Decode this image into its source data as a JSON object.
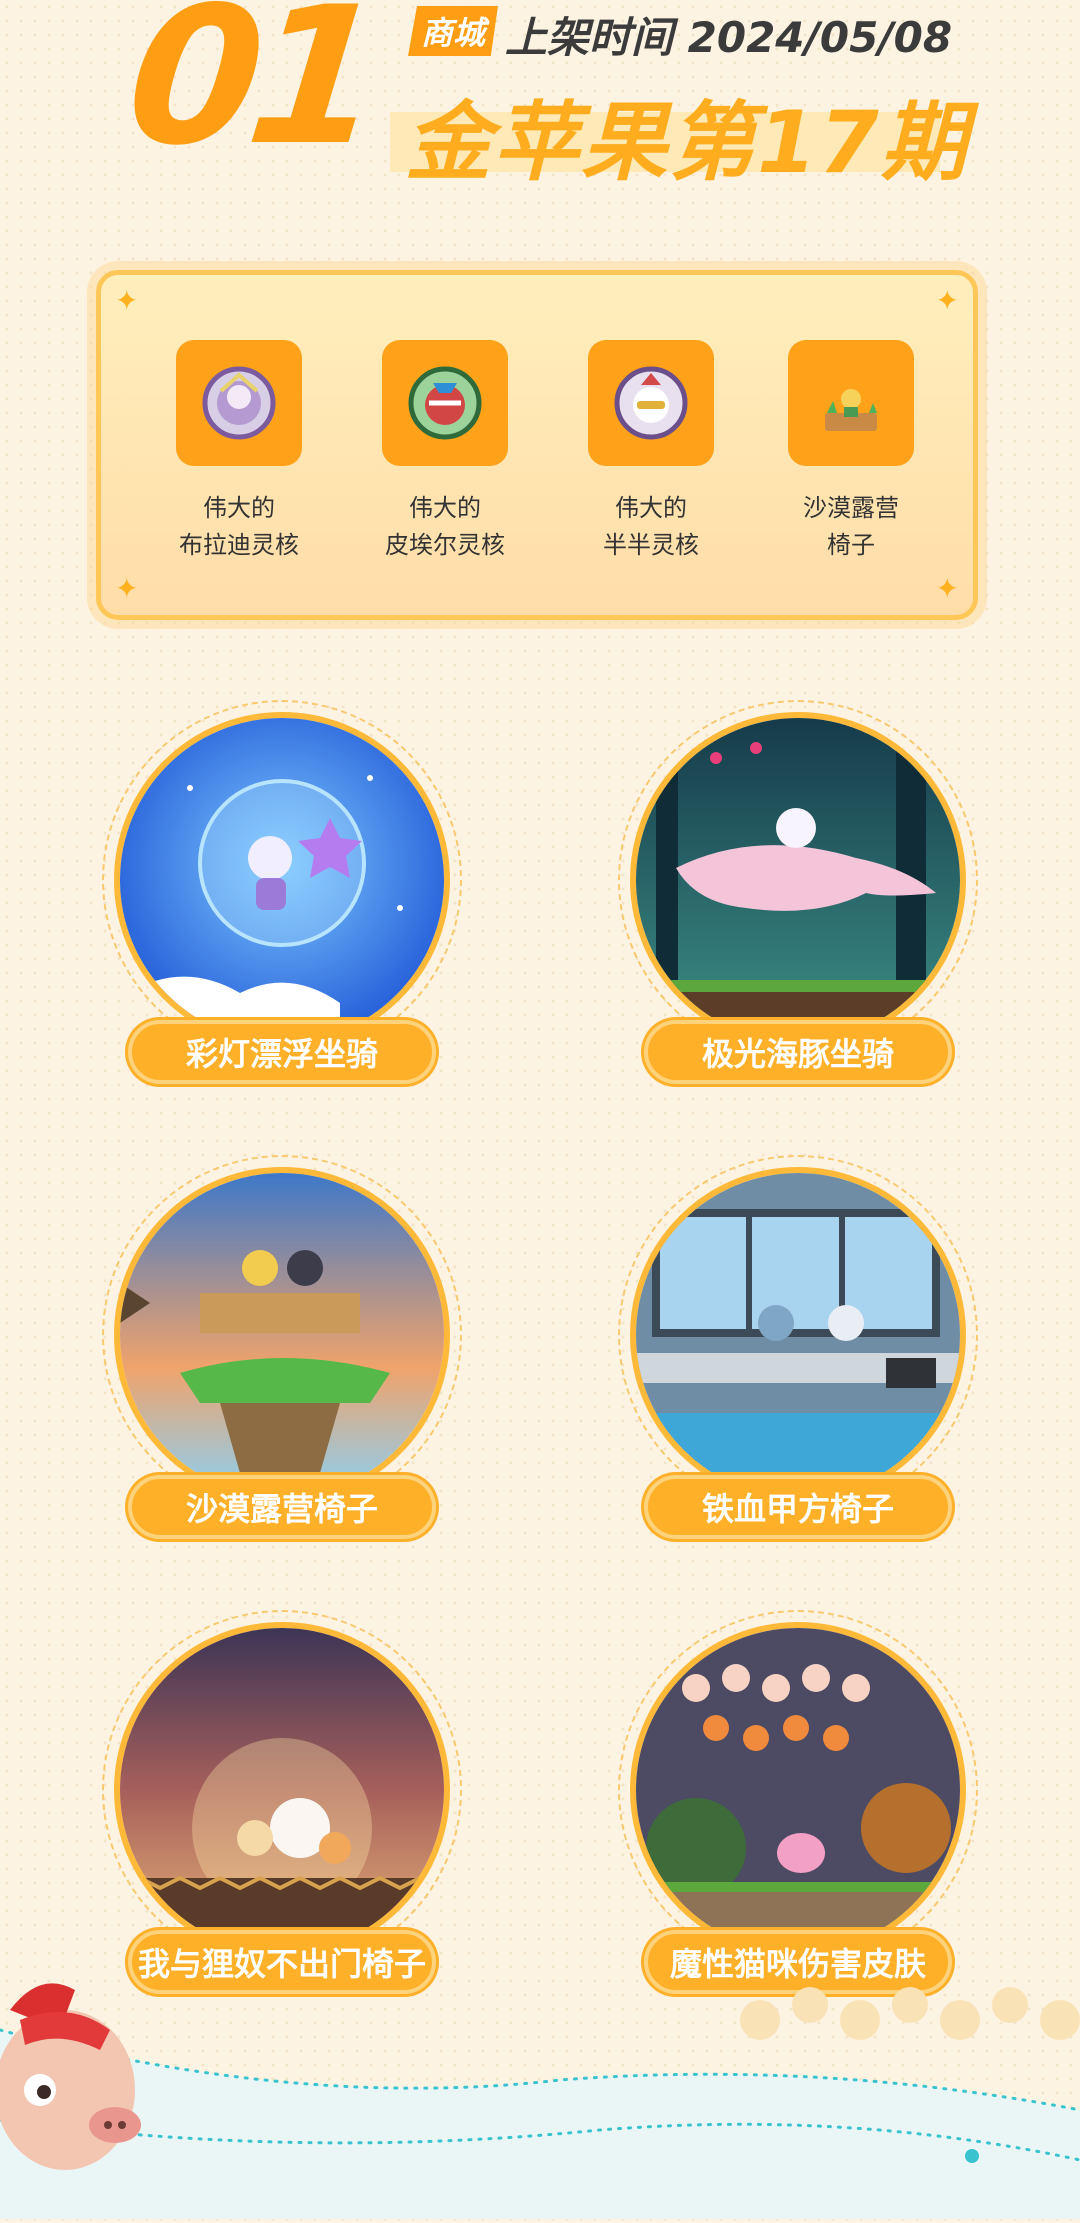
{
  "header": {
    "number": "01",
    "tag": "商城",
    "date_line": "上架时间 2024/05/08",
    "title": "金苹果第17期"
  },
  "featured": {
    "items": [
      {
        "line1": "伟大的",
        "line2": "布拉迪灵核",
        "icon": "spirit-core-bradi-icon"
      },
      {
        "line1": "伟大的",
        "line2": "皮埃尔灵核",
        "icon": "spirit-core-pierre-icon"
      },
      {
        "line1": "伟大的",
        "line2": "半半灵核",
        "icon": "spirit-core-banban-icon"
      },
      {
        "line1": "沙漠露营",
        "line2": "椅子",
        "icon": "desert-camp-chair-icon"
      }
    ]
  },
  "cards": [
    {
      "label": "彩灯漂浮坐骑"
    },
    {
      "label": "极光海豚坐骑"
    },
    {
      "label": "沙漠露营椅子"
    },
    {
      "label": "铁血甲方椅子"
    },
    {
      "label": "我与狸奴不出门椅子"
    },
    {
      "label": "魔性猫咪伤害皮肤"
    }
  ],
  "colors": {
    "accent": "#ff9e12",
    "background": "#fdf3e2",
    "pill": "#ffb029"
  }
}
